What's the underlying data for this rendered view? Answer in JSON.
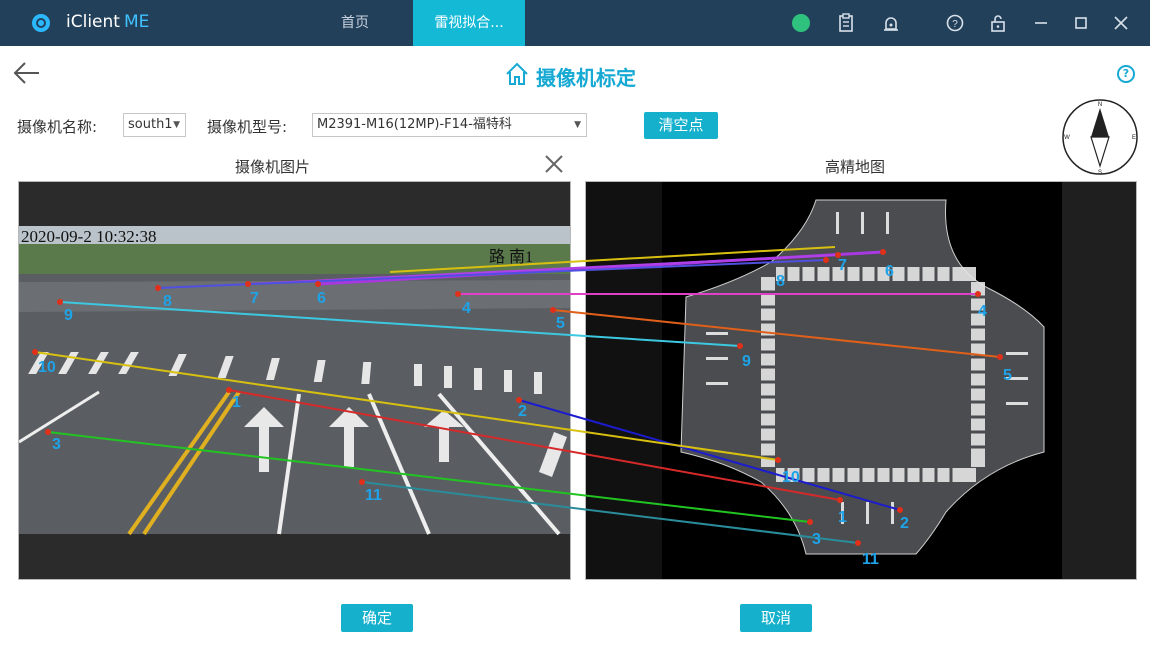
{
  "app": {
    "name": "iClient",
    "name_suffix": "ME",
    "tabs": [
      {
        "label": "首页",
        "active": false
      },
      {
        "label": "雷视拟合...",
        "active": true
      }
    ],
    "toolbar_icons": [
      "sync-icon",
      "clipboard-icon",
      "alarm-icon",
      "help-icon",
      "lock-icon",
      "minimize-icon",
      "maximize-icon",
      "close-icon"
    ]
  },
  "page": {
    "title": "摄像机标定",
    "help_glyph": "?"
  },
  "form": {
    "camera_name_label": "摄像机名称:",
    "camera_name_value": "south1",
    "camera_model_label": "摄像机型号:",
    "camera_model_value": "M2391-M16(12MP)-F14-福特科",
    "clear_points_label": "清空点"
  },
  "compass": {
    "north": "N",
    "south": "S",
    "east": "E",
    "west": "W"
  },
  "panels": {
    "camera_image_title": "摄像机图片",
    "hd_map_title": "高精地图",
    "camera_timestamp": "2020-09-2 10:32:38",
    "camera_street_text": "路 南1"
  },
  "calibration_points": [
    {
      "id": "1",
      "color": "#d62a2a"
    },
    {
      "id": "2",
      "color": "#1c1ccf"
    },
    {
      "id": "3",
      "color": "#22c422"
    },
    {
      "id": "4",
      "color": "#e040c8"
    },
    {
      "id": "5",
      "color": "#e0601a"
    },
    {
      "id": "6",
      "color": "#a838e0"
    },
    {
      "id": "7",
      "color": "#b040e8"
    },
    {
      "id": "8",
      "color": "#5050e0"
    },
    {
      "id": "9",
      "color": "#3cc8e0"
    },
    {
      "id": "10",
      "color": "#d8c010"
    },
    {
      "id": "11",
      "color": "#2a8c9a"
    }
  ],
  "buttons": {
    "confirm": "确定",
    "cancel": "取消"
  },
  "colors": {
    "titlebar": "#23405a",
    "accent": "#14b0cc",
    "title_text": "#16a9d3",
    "point_label": "#1ea3e8"
  }
}
